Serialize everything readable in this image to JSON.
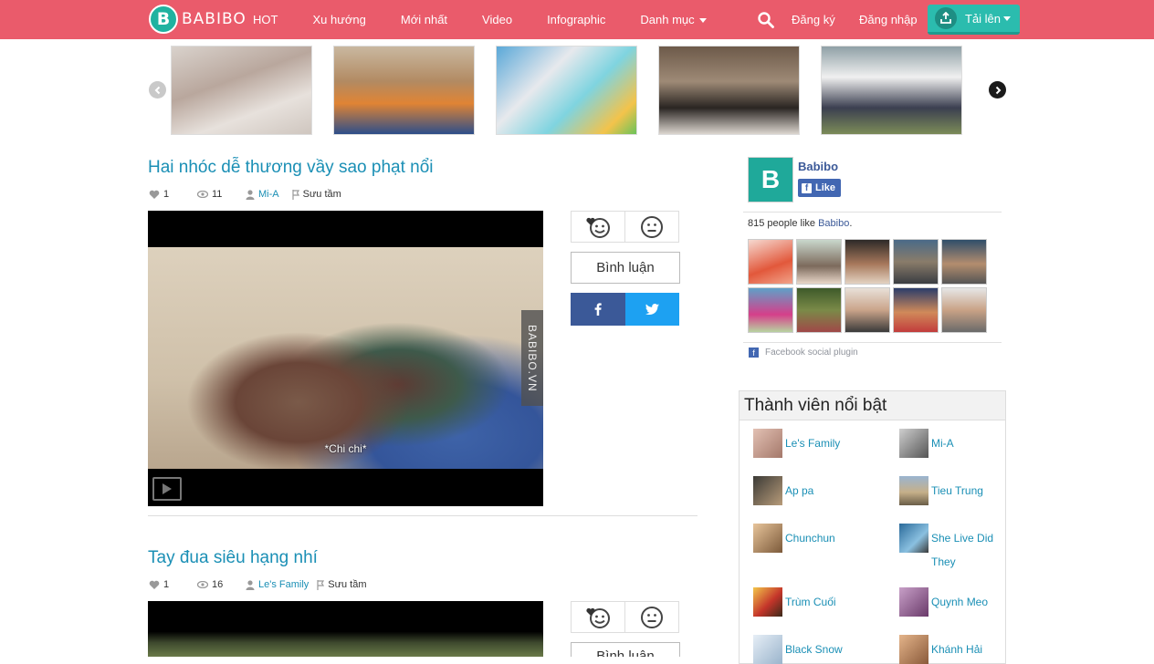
{
  "header": {
    "logo_text": "BABIBO",
    "nav": [
      {
        "label": "HOT"
      },
      {
        "label": "Xu hướng"
      },
      {
        "label": "Mới nhất"
      },
      {
        "label": "Video"
      },
      {
        "label": "Infographic"
      },
      {
        "label": "Danh mục"
      }
    ],
    "register": "Đăng ký",
    "login": "Đăng nhập",
    "upload": "Tải lên"
  },
  "posts": [
    {
      "title": "Hai nhóc dễ thương vầy sao phạt nổi",
      "likes": "1",
      "views": "11",
      "author": "Mi-A",
      "source": "Sưu tầm",
      "caption": "*Chi chi*",
      "watermark": "BABIBO.VN",
      "comment_label": "Bình luận"
    },
    {
      "title": "Tay đua siêu hạng nhí",
      "likes": "1",
      "views": "16",
      "author": "Le's Family",
      "source": "Sưu tầm",
      "comment_label": "Bình luận"
    }
  ],
  "fb_widget": {
    "page_name": "Babibo",
    "like_label": "Like",
    "count_text": "815 people like",
    "count_link": "Babibo",
    "plugin_label": "Facebook social plugin"
  },
  "members": {
    "title": "Thành viên nổi bật",
    "items": [
      {
        "name": "Le's Family",
        "color": "#c9a090"
      },
      {
        "name": "Mi-A",
        "color": "#8e8e8e"
      },
      {
        "name": "Ap pa",
        "color": "#7c6a55"
      },
      {
        "name": "Tieu Trung",
        "color": "#a89d84"
      },
      {
        "name": "Chunchun",
        "color": "#b58e5e"
      },
      {
        "name": "She Live Did They",
        "color": "#3e7aa8"
      },
      {
        "name": "Trùm Cuối",
        "color": "#d9a23a"
      },
      {
        "name": "Quynh Meo",
        "color": "#8a6a9a"
      },
      {
        "name": "Black Snow",
        "color": "#c3d3e0"
      },
      {
        "name": "Khánh Hải",
        "color": "#c79a6a"
      }
    ]
  },
  "colors": {
    "header_bg": "#ea5b6b",
    "accent": "#1a8fb5",
    "upload_bg": "#2bbcae",
    "facebook": "#3b5998",
    "twitter": "#1da1f2"
  }
}
